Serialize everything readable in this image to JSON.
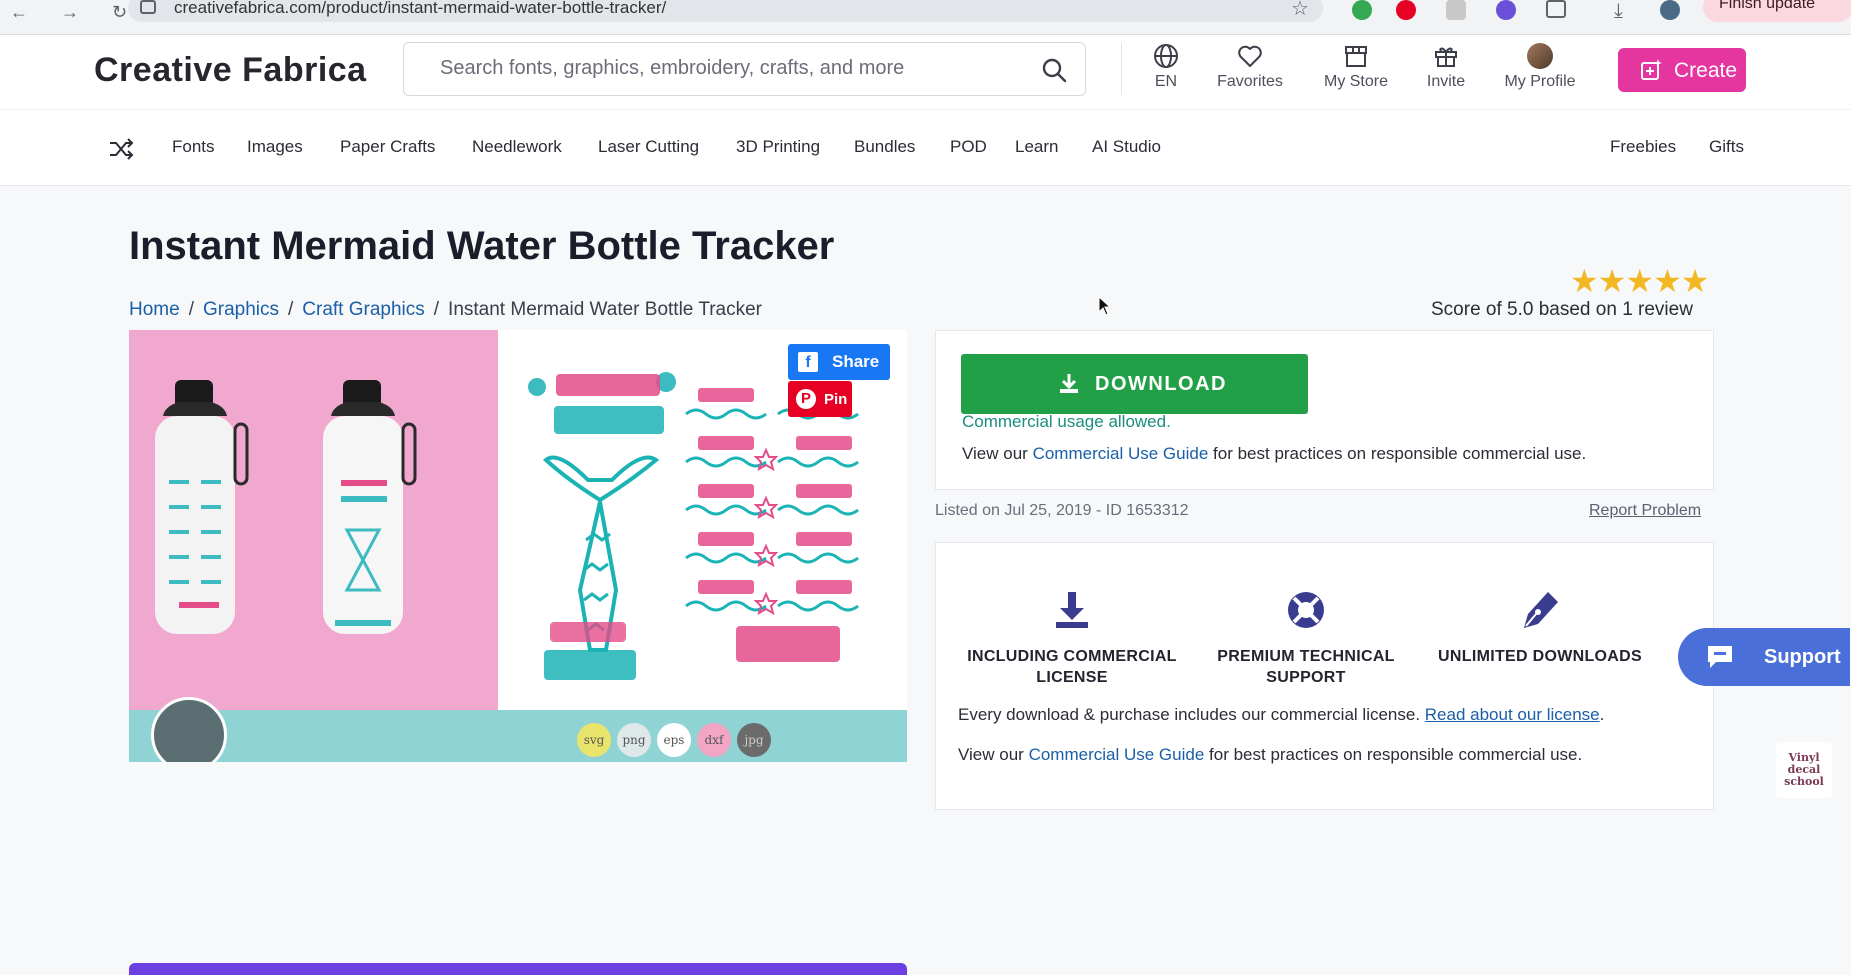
{
  "browser": {
    "url": "creativefabrica.com/product/instant-mermaid-water-bottle-tracker/",
    "finish_update_label": "Finish update"
  },
  "header": {
    "logo": "Creative Fabrica",
    "search_placeholder": "Search fonts, graphics, embroidery, crafts, and more",
    "language": "EN",
    "favorites": "Favorites",
    "my_store": "My Store",
    "invite": "Invite",
    "my_profile": "My Profile",
    "create": "Create"
  },
  "nav": {
    "items": [
      "Fonts",
      "Images",
      "Paper Crafts",
      "Needlework",
      "Laser Cutting",
      "3D Printing",
      "Bundles",
      "POD",
      "Learn",
      "AI Studio"
    ],
    "right_items": [
      "Freebies",
      "Gifts"
    ]
  },
  "product": {
    "title": "Instant Mermaid Water Bottle Tracker",
    "breadcrumbs": [
      "Home",
      "Graphics",
      "Craft Graphics",
      "Instant Mermaid Water Bottle Tracker"
    ],
    "breadcrumb_separator": "/",
    "rating_stars": 5,
    "stars_glyph": "★★★★★",
    "score_text": "Score of 5.0 based on 1 review",
    "share_label": "Share",
    "pin_label": "Pin",
    "formats": [
      "svg",
      "png",
      "eps",
      "dxf",
      "jpg"
    ]
  },
  "download_card": {
    "download_label": "DOWNLOAD",
    "commercial_text": "Commercial usage allowed.",
    "guide_prefix": "View our ",
    "guide_link": "Commercial Use Guide",
    "guide_suffix": " for best practices on responsible commercial use."
  },
  "meta": {
    "listed": "Listed on Jul 25, 2019 - ID 1653312",
    "report": "Report Problem"
  },
  "features": {
    "items": [
      {
        "label": "INCLUDING COMMERCIAL LICENSE",
        "icon": "download-tray-icon"
      },
      {
        "label": "PREMIUM TECHNICAL SUPPORT",
        "icon": "lifebuoy-icon"
      },
      {
        "label": "UNLIMITED DOWNLOADS",
        "icon": "pen-nib-icon"
      }
    ],
    "license_prefix": "Every download & purchase includes our commercial license. ",
    "license_link": "Read about our license",
    "license_suffix": ".",
    "guide_prefix": "View our ",
    "guide_link": "Commercial Use Guide",
    "guide_suffix": " for best practices on responsible commercial use."
  },
  "support": {
    "label": "Support"
  },
  "watermark": "Vinyl decal school",
  "colors": {
    "create": "#e5359f",
    "download": "#21a047",
    "link": "#1b5fa8",
    "support": "#4a6fd8",
    "stars": "#f2b824"
  }
}
